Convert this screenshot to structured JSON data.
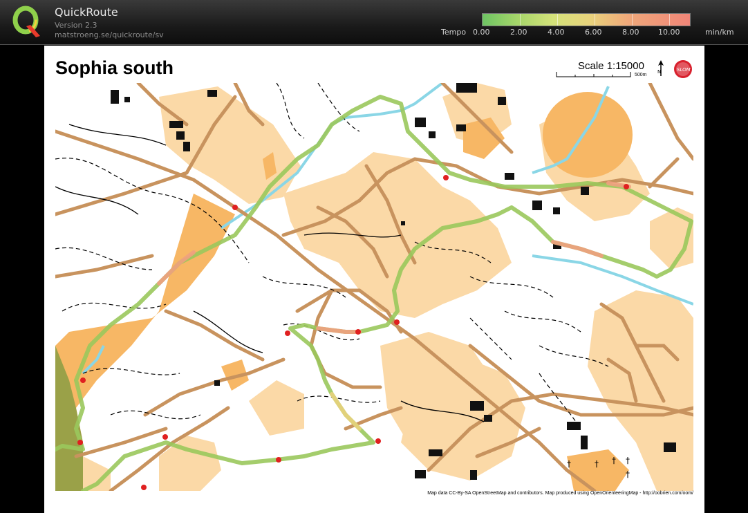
{
  "app": {
    "name": "QuickRoute",
    "version": "Version 2.3",
    "url": "matstroeng.se/quickroute/sv"
  },
  "tempo": {
    "label": "Tempo",
    "unit": "min/km",
    "ticks": [
      "0.00",
      "2.00",
      "4.00",
      "6.00",
      "8.00",
      "10.00"
    ],
    "colors": [
      "#6ec463",
      "#d4e27a",
      "#e8d27c",
      "#f08578"
    ]
  },
  "map": {
    "title": "Sophia south",
    "scale": "Scale 1:15000",
    "scale_unit": "500m",
    "north_label": "N",
    "club_logo_text": "SLOM",
    "credit": "Map data CC-By-SA OpenStreetMap and contributors. Map produced using OpenOrienteeringMap - http://oobrien.com/oom/",
    "colors": {
      "open_land": "#fbd9a7",
      "rough_open": "#f7b765",
      "road": "#c8935e",
      "water": "#8ad6e6",
      "building": "#111111",
      "route_green": "#9ac85c",
      "route_slow": "#f0a080"
    }
  }
}
